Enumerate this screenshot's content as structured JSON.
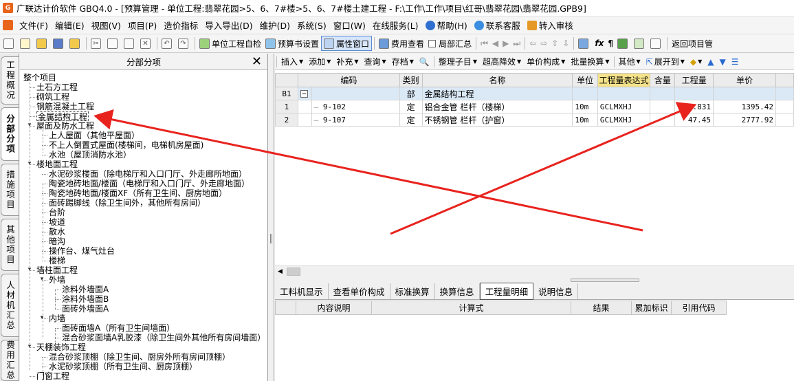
{
  "window": {
    "title": "广联达计价软件 GBQ4.0 - [预算管理 - 单位工程:翡翠花园>5、6、7#楼>5、6、7#楼土建工程 - F:\\工作\\工作\\项目\\红哥\\翡翠花园\\翡翠花园.GPB9]"
  },
  "menu": {
    "items": [
      "文件(F)",
      "编辑(E)",
      "视图(V)",
      "项目(P)",
      "造价指标",
      "导入导出(D)",
      "维护(D)",
      "系统(S)",
      "窗口(W)",
      "在线服务(L)",
      "帮助(H)",
      "联系客服",
      "转入审核"
    ]
  },
  "toolbar": {
    "self_check": "单位工程自检",
    "budget_settings": "预算书设置",
    "property_window": "属性窗口",
    "fee_view": "费用查看",
    "local_summary": "局部汇总",
    "return_project": "返回项目管"
  },
  "vtabs": [
    "工程概况",
    "分部分项",
    "措施项目",
    "其他项目",
    "人材机汇总",
    "费用汇总"
  ],
  "tree": {
    "header": "分部分项",
    "nodes": [
      {
        "label": "整个项目"
      },
      {
        "label": "土石方工程"
      },
      {
        "label": "砌筑工程"
      },
      {
        "label": "钢筋混凝土工程"
      },
      {
        "label": "金属结构工程"
      },
      {
        "label": "屋面及防水工程"
      },
      {
        "label": "上人屋面（其他平屋面）"
      },
      {
        "label": "不上人倒置式屋面(楼梯间，电梯机房屋面)"
      },
      {
        "label": "水池（屋顶消防水池）"
      },
      {
        "label": "楼地面工程"
      },
      {
        "label": "水泥砂浆楼面（除电梯厅和入口门厅、外走廊所地面）"
      },
      {
        "label": "陶瓷地砖地面/楼面（电梯厅和入口门厅、外走廊地面）"
      },
      {
        "label": "陶瓷地砖地面/楼面XF（所有卫生间、厨房地面）"
      },
      {
        "label": "面砖踢脚线（除卫生间外，其他所有房间）"
      },
      {
        "label": "台阶"
      },
      {
        "label": "坡道"
      },
      {
        "label": "散水"
      },
      {
        "label": "暗沟"
      },
      {
        "label": "操作台、煤气灶台"
      },
      {
        "label": "楼梯"
      },
      {
        "label": "墙柱面工程"
      },
      {
        "label": "外墙"
      },
      {
        "label": "涂料外墙面A"
      },
      {
        "label": "涂料外墙面B"
      },
      {
        "label": "面砖外墙面A"
      },
      {
        "label": "内墙"
      },
      {
        "label": "面砖面墙A（所有卫生间墙面）"
      },
      {
        "label": "混合砂浆面墙A乳胶漆（除卫生间外其他所有房间墙面）"
      },
      {
        "label": "天棚装饰工程"
      },
      {
        "label": "混合砂浆顶棚（除卫生间、厨房外所有房间顶棚）"
      },
      {
        "label": "水泥砂浆顶棚（所有卫生间、厨房顶棚）"
      },
      {
        "label": "门窗工程"
      }
    ]
  },
  "rtoolbar": {
    "items": [
      "插入",
      "添加",
      "补充",
      "查询",
      "存档",
      "整理子目",
      "超高降效",
      "单价构成",
      "批量换算",
      "其他",
      "展开到"
    ]
  },
  "grid": {
    "columns": [
      "编码",
      "类别",
      "名称",
      "单位",
      "工程量表达式",
      "含量",
      "工程量",
      "单价"
    ],
    "rows": [
      {
        "rowno": "B1",
        "toggle": "−",
        "code": "",
        "type": "部",
        "name": "金属结构工程",
        "unit": "",
        "expr": "",
        "content": "",
        "qty": "",
        "price": ""
      },
      {
        "rowno": "1",
        "toggle": "",
        "code": "9-102",
        "type": "定",
        "name": "铝合金管 栏杆（楼梯）",
        "unit": "10m",
        "expr": "GCLMXHJ",
        "content": "",
        "qty": "8.831",
        "price": "1395.42"
      },
      {
        "rowno": "2",
        "toggle": "",
        "code": "9-107",
        "type": "定",
        "name": "不锈钢管 栏杆（护窗）",
        "unit": "10m",
        "expr": "GCLMXHJ",
        "content": "",
        "qty": "47.45",
        "price": "2777.92"
      }
    ]
  },
  "bottom_tabs": [
    "工料机显示",
    "查看单价构成",
    "标准换算",
    "换算信息",
    "工程量明细",
    "说明信息"
  ],
  "detail_grid": {
    "columns": [
      "内容说明",
      "计算式",
      "结果",
      "累加标识",
      "引用代码"
    ]
  },
  "colors": {
    "annotation": "#e8231e",
    "selected_row": "#dbe9f7",
    "highlight_header": "#f5e38a"
  }
}
